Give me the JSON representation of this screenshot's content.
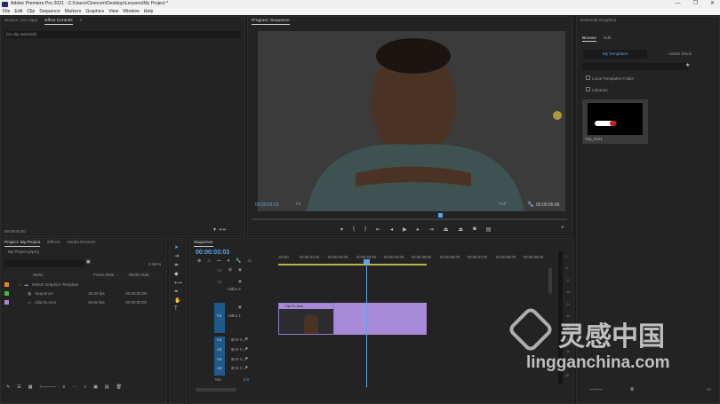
{
  "window": {
    "title": "Adobe Premiere Pro 2021 - C:\\Users\\Cinecom\\Desktop\\Lessons\\My Project *",
    "controls": [
      "—",
      "❐",
      "✕"
    ]
  },
  "menu": [
    "File",
    "Edit",
    "Clip",
    "Sequence",
    "Markers",
    "Graphics",
    "View",
    "Window",
    "Help"
  ],
  "source_panel": {
    "tabs": [
      "Source: (no clips)",
      "Effect Controls",
      "≡"
    ],
    "message": "(no clip selected)",
    "timecode": "00:00:00:00"
  },
  "program_panel": {
    "title": "Program: Sequence",
    "current_time": "00:00:03:03",
    "fit": "Fit",
    "quality": "Full",
    "duration": "00:00:05:06"
  },
  "project_panel": {
    "tabs": [
      "Project: My Project",
      "Effects",
      "Media Browser"
    ],
    "project_file": "My Project.prproj",
    "item_count": "3 items",
    "columns": [
      "Name",
      "Frame Rate",
      "Media Start"
    ],
    "items": [
      {
        "name": "Motion Graphics Template",
        "frame_rate": "",
        "media_start": "",
        "color": "#e08a2a"
      },
      {
        "name": "Sequence",
        "frame_rate": "25,00 fps",
        "media_start": "00:00:00:00",
        "color": "#52b045"
      },
      {
        "name": "Clip 01.mov",
        "frame_rate": "60,00 fps",
        "media_start": "00:00:00:00",
        "color": "#a78ad8"
      }
    ]
  },
  "timeline": {
    "tab": "Sequence",
    "current_time": "00:00:03:03",
    "ruler": [
      ":00:00",
      "00:00:01:00",
      "00:00:02:00",
      "00:00:03:00",
      "00:00:04:00",
      "00:00:05:00",
      "00:00:06:00",
      "00:00:07:00",
      "00:00:08:00",
      "00:00:09:00"
    ],
    "video_tracks": [
      {
        "id": "V3",
        "name": ""
      },
      {
        "id": "V2",
        "name": "Video 2"
      },
      {
        "id": "V1",
        "name": "Video 1"
      }
    ],
    "audio_tracks": [
      "A1",
      "A2",
      "A3",
      "A4"
    ],
    "mix_label": "Mix",
    "mix_value": "0,0",
    "clip_label": "Clip 01.mov",
    "meter_scale": [
      "0",
      "-6",
      "-12",
      "-18",
      "-24",
      "-30",
      "-36",
      "-42",
      "-48",
      "-54",
      "dB"
    ]
  },
  "essential_graphics": {
    "title": "Essential Graphics",
    "tabs": [
      "Browse",
      "Edit"
    ],
    "sub_tabs": [
      "My Templates",
      "Adobe Stock"
    ],
    "options": [
      "Local Templates Folder",
      "Libraries"
    ],
    "template_name": "Clip_0101"
  },
  "watermark": {
    "brand": "灵感中国",
    "url": "lingganchina.com"
  }
}
